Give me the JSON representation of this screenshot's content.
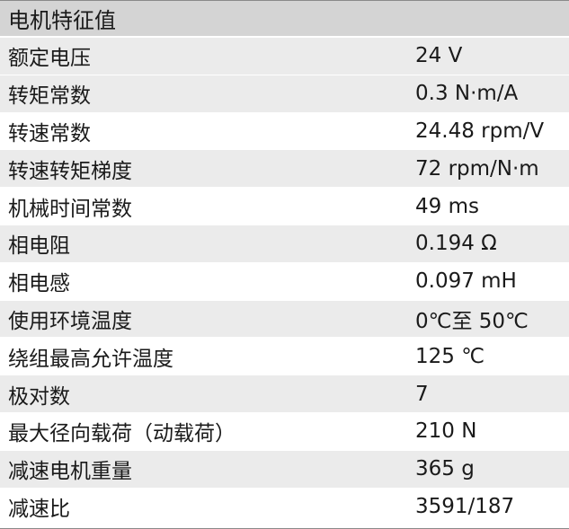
{
  "table": {
    "title": "电机特征值",
    "rows": [
      {
        "label": "额定电压",
        "value": "24 V"
      },
      {
        "label": "转矩常数",
        "value": "0.3 N·m/A"
      },
      {
        "label": "转速常数",
        "value": "24.48 rpm/V"
      },
      {
        "label": "转速转矩梯度",
        "value": "72 rpm/N·m"
      },
      {
        "label": "机械时间常数",
        "value": "49 ms"
      },
      {
        "label": "相电阻",
        "value": "0.194 Ω"
      },
      {
        "label": "相电感",
        "value": "0.097 mH"
      },
      {
        "label": "使用环境温度",
        "value": "0℃至 50℃"
      },
      {
        "label": "绕组最高允许温度",
        "value": "125 ℃"
      },
      {
        "label": "极对数",
        "value": "7"
      },
      {
        "label": "最大径向载荷（动载荷）",
        "value": "210 N"
      },
      {
        "label": "减速电机重量",
        "value": "365 g"
      },
      {
        "label": "减速比",
        "value": "3591/187"
      }
    ]
  },
  "colors": {
    "header_bg": "#d4d4d4",
    "row_shaded_bg": "#ebebeb",
    "row_plain_bg": "#ffffff",
    "text": "#1a1a1a"
  }
}
